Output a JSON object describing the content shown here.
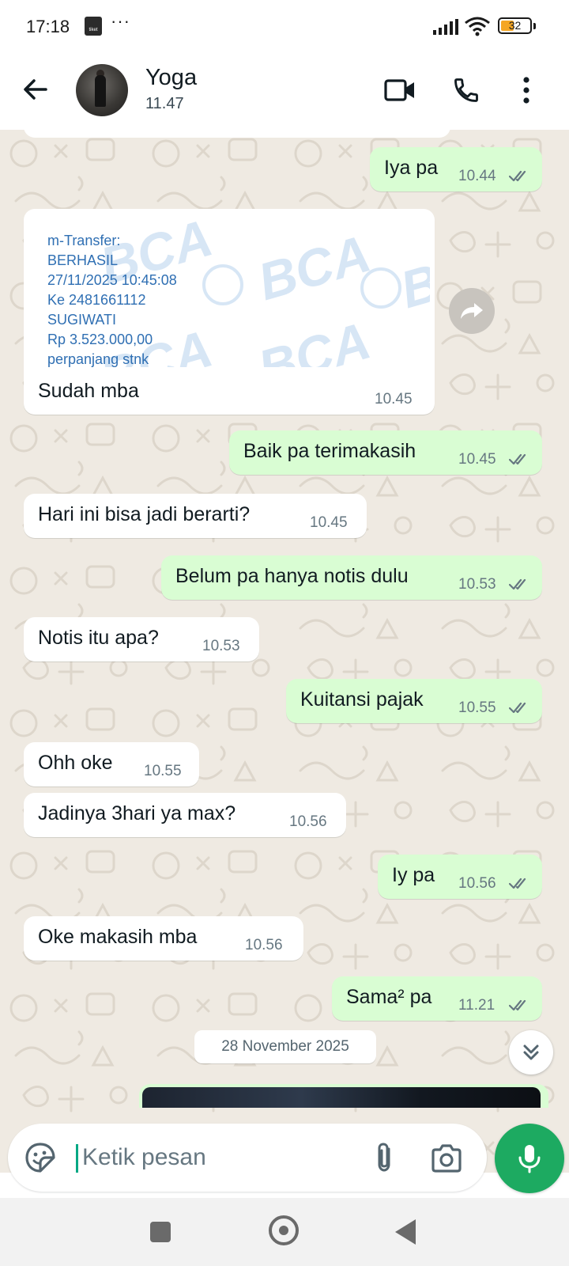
{
  "status_bar": {
    "time": "17:18",
    "app_icon_text": "tiket",
    "more_dots": "···",
    "battery": "32"
  },
  "header": {
    "contact_name": "Yoga",
    "contact_status": "11.47",
    "icons": [
      "back-arrow-icon",
      "video-call-icon",
      "voice-call-icon",
      "more-vert-icon"
    ]
  },
  "receipt": {
    "lines": [
      "m-Transfer:",
      "BERHASIL",
      "27/11/2025 10:45:08",
      "Ke 2481661112",
      "SUGIWATI",
      "Rp 3.523.000,00",
      "perpanjang stnk"
    ],
    "watermark": "BCA",
    "caption": "Sudah mba",
    "time": "10.45"
  },
  "messages": [
    {
      "dir": "out",
      "text": "Iya pa",
      "time": "10.44"
    },
    {
      "dir": "out",
      "text": "Baik pa terimakasih",
      "time": "10.45"
    },
    {
      "dir": "in",
      "text": "Hari ini bisa jadi berarti?",
      "time": "10.45"
    },
    {
      "dir": "out",
      "text": "Belum pa hanya notis dulu",
      "time": "10.53"
    },
    {
      "dir": "in",
      "text": "Notis itu apa?",
      "time": "10.53"
    },
    {
      "dir": "out",
      "text": "Kuitansi pajak",
      "time": "10.55"
    },
    {
      "dir": "in",
      "text": "Ohh oke",
      "time": "10.55"
    },
    {
      "dir": "in",
      "text": "Jadinya 3hari ya max?",
      "time": "10.56"
    },
    {
      "dir": "out",
      "text": "Iy pa",
      "time": "10.56"
    },
    {
      "dir": "in",
      "text": "Oke makasih mba",
      "time": "10.56"
    },
    {
      "dir": "out",
      "text": "Sama² pa",
      "time": "11.21"
    }
  ],
  "date_chip": "28 November 2025",
  "composer": {
    "placeholder": "Ketik pesan"
  },
  "colors": {
    "outgoing_bubble": "#d9fdd3",
    "incoming_bubble": "#ffffff",
    "chat_background": "#efeae2",
    "read_ticks": "#667781",
    "mic_button": "#1daa61"
  }
}
